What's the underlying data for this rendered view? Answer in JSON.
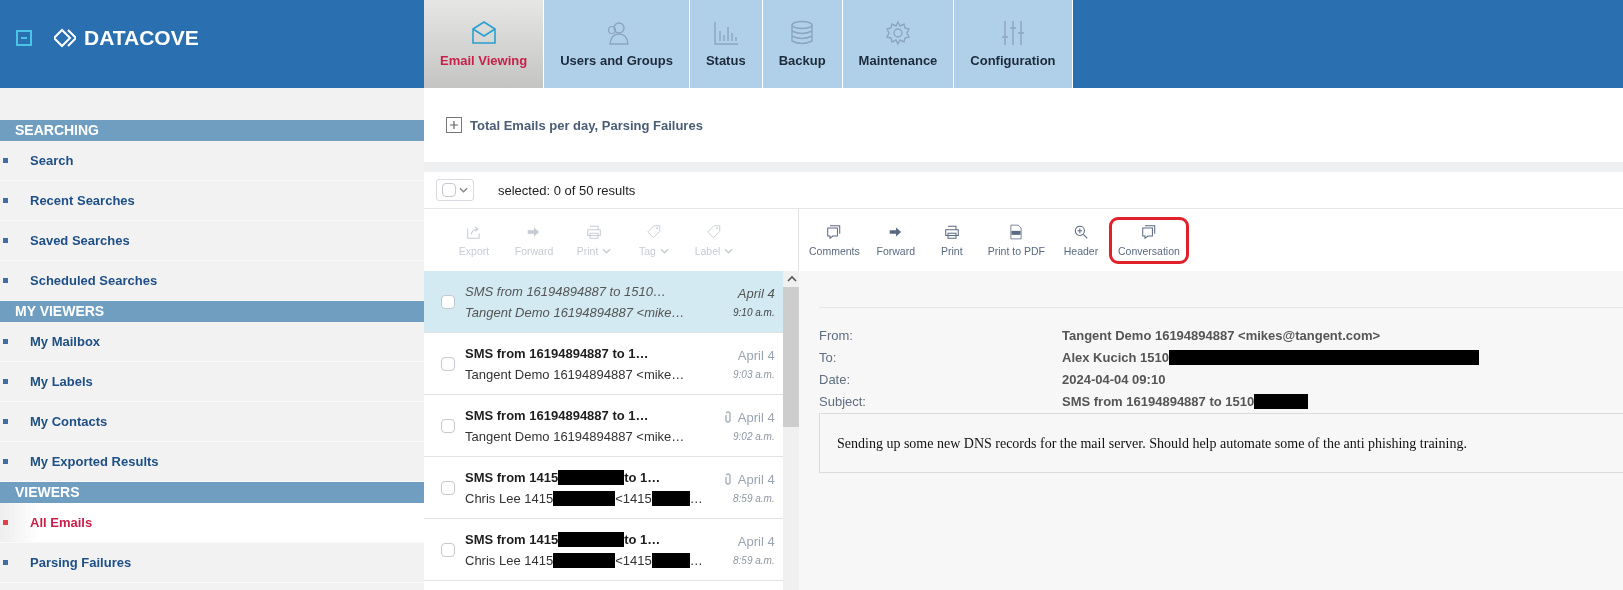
{
  "app": {
    "logo": "DATACOVE"
  },
  "tabs": [
    {
      "label": "Email Viewing",
      "selected": true
    },
    {
      "label": "Users and Groups",
      "selected": false
    },
    {
      "label": "Status",
      "selected": false
    },
    {
      "label": "Backup",
      "selected": false
    },
    {
      "label": "Maintenance",
      "selected": false
    },
    {
      "label": "Configuration",
      "selected": false
    }
  ],
  "sidebar": {
    "sections": [
      {
        "title": "SEARCHING",
        "items": [
          {
            "label": "Search",
            "selected": false
          },
          {
            "label": "Recent Searches",
            "selected": false
          },
          {
            "label": "Saved Searches",
            "selected": false
          },
          {
            "label": "Scheduled Searches",
            "selected": false
          }
        ]
      },
      {
        "title": "MY VIEWERS",
        "items": [
          {
            "label": "My Mailbox",
            "selected": false
          },
          {
            "label": "My Labels",
            "selected": false
          },
          {
            "label": "My Contacts",
            "selected": false
          },
          {
            "label": "My Exported Results",
            "selected": false
          }
        ]
      },
      {
        "title": "VIEWERS",
        "items": [
          {
            "label": "All Emails",
            "selected": true
          },
          {
            "label": "Parsing Failures",
            "selected": false
          }
        ]
      }
    ]
  },
  "chart_panel": {
    "title": "Total Emails per day, Parsing Failures",
    "expanded": false
  },
  "selection": {
    "checked": false,
    "summary": "selected: 0 of 50 results"
  },
  "list_toolbar": [
    {
      "label": "Export",
      "dropdown": false,
      "disabled": true
    },
    {
      "label": "Forward",
      "dropdown": false,
      "disabled": true
    },
    {
      "label": "Print",
      "dropdown": true,
      "disabled": true
    },
    {
      "label": "Tag",
      "dropdown": true,
      "disabled": true
    },
    {
      "label": "Label",
      "dropdown": true,
      "disabled": true
    }
  ],
  "message_toolbar": [
    {
      "label": "Comments",
      "highlighted": false
    },
    {
      "label": "Forward",
      "highlighted": false
    },
    {
      "label": "Print",
      "highlighted": false
    },
    {
      "label": "Print to PDF",
      "highlighted": false
    },
    {
      "label": "Header",
      "highlighted": false
    },
    {
      "label": "Conversation",
      "highlighted": true
    }
  ],
  "emails": [
    {
      "subject": [
        "SMS from 16194894887 to 1510…"
      ],
      "sender": [
        "Tangent Demo 16194894887 <mike…"
      ],
      "date": "April 4",
      "time": "9:10 a.m.",
      "attachment": false,
      "unread": false,
      "selected": true,
      "checked": false
    },
    {
      "subject": [
        "SMS from 16194894887 to 1…"
      ],
      "sender": [
        "Tangent Demo 16194894887 <mike…"
      ],
      "date": "April 4",
      "time": "9:03 a.m.",
      "attachment": false,
      "unread": true,
      "selected": false,
      "checked": false
    },
    {
      "subject": [
        "SMS from 16194894887 to 1…"
      ],
      "sender": [
        "Tangent Demo 16194894887 <mike…"
      ],
      "date": "April 4",
      "time": "9:02 a.m.",
      "attachment": true,
      "unread": true,
      "selected": false,
      "checked": false
    },
    {
      "subject": [
        "SMS from 1415",
        "to 1…"
      ],
      "sender": [
        "Chris Lee 1415",
        "<1415",
        "…"
      ],
      "date": "April 4",
      "time": "8:59 a.m.",
      "attachment": true,
      "unread": true,
      "selected": false,
      "checked": false
    },
    {
      "subject": [
        "SMS from 1415",
        "to 1…"
      ],
      "sender": [
        "Chris Lee 1415",
        "<1415",
        "…"
      ],
      "date": "April 4",
      "time": "8:59 a.m.",
      "attachment": false,
      "unread": true,
      "selected": false,
      "checked": false
    }
  ],
  "message": {
    "headers": [
      {
        "label": "From:",
        "value": [
          "Tangent Demo 16194894887 <mikes@tangent.com>"
        ],
        "redacted_end": false
      },
      {
        "label": "To:",
        "value": [
          "Alex Kucich 1510"
        ],
        "redacted_end": true
      },
      {
        "label": "Date:",
        "value": [
          "2024-04-04 09:10"
        ],
        "redacted_end": false
      },
      {
        "label": "Subject:",
        "value": [
          "SMS from 16194894887 to 1510"
        ],
        "redacted_end": true
      }
    ],
    "body": "Sending up some new DNS records for the mail server. Should help automate some of the anti phishing training."
  }
}
